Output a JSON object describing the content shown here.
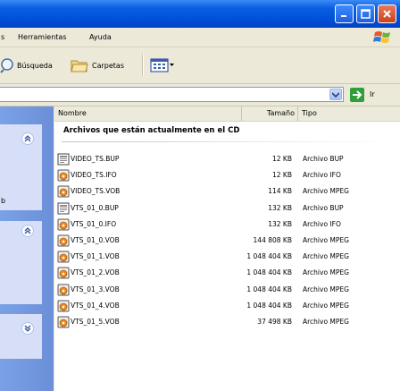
{
  "menu": [
    "s",
    "Herramientas",
    "Ayuda"
  ],
  "toolbar": {
    "search_label": "Búsqueda",
    "folders_label": "Carpetas"
  },
  "address": {
    "go_label": "Ir"
  },
  "taskpane": {
    "fragment": "b"
  },
  "columns": {
    "name": "Nombre",
    "size": "Tamaño",
    "type": "Tipo"
  },
  "group_header": "Archivos que están actualmente en el CD",
  "files": [
    {
      "name": "VIDEO_TS.BUP",
      "size": "12 KB",
      "type": "Archivo BUP",
      "icon": "bup-file-icon"
    },
    {
      "name": "VIDEO_TS.IFO",
      "size": "12 KB",
      "type": "Archivo IFO",
      "icon": "media-file-icon"
    },
    {
      "name": "VIDEO_TS.VOB",
      "size": "114 KB",
      "type": "Archivo MPEG",
      "icon": "media-file-icon"
    },
    {
      "name": "VTS_01_0.BUP",
      "size": "132 KB",
      "type": "Archivo BUP",
      "icon": "bup-file-icon"
    },
    {
      "name": "VTS_01_0.IFO",
      "size": "132 KB",
      "type": "Archivo IFO",
      "icon": "media-file-icon"
    },
    {
      "name": "VTS_01_0.VOB",
      "size": "144 808 KB",
      "type": "Archivo MPEG",
      "icon": "media-file-icon"
    },
    {
      "name": "VTS_01_1.VOB",
      "size": "1 048 404 KB",
      "type": "Archivo MPEG",
      "icon": "media-file-icon"
    },
    {
      "name": "VTS_01_2.VOB",
      "size": "1 048 404 KB",
      "type": "Archivo MPEG",
      "icon": "media-file-icon"
    },
    {
      "name": "VTS_01_3.VOB",
      "size": "1 048 404 KB",
      "type": "Archivo MPEG",
      "icon": "media-file-icon"
    },
    {
      "name": "VTS_01_4.VOB",
      "size": "1 048 404 KB",
      "type": "Archivo MPEG",
      "icon": "media-file-icon"
    },
    {
      "name": "VTS_01_5.VOB",
      "size": "37 498 KB",
      "type": "Archivo MPEG",
      "icon": "media-file-icon"
    }
  ],
  "colors": {
    "titlebar": "#0a5ee0",
    "taskpane": "#7aa1e6",
    "panel": "#d6dff7"
  }
}
